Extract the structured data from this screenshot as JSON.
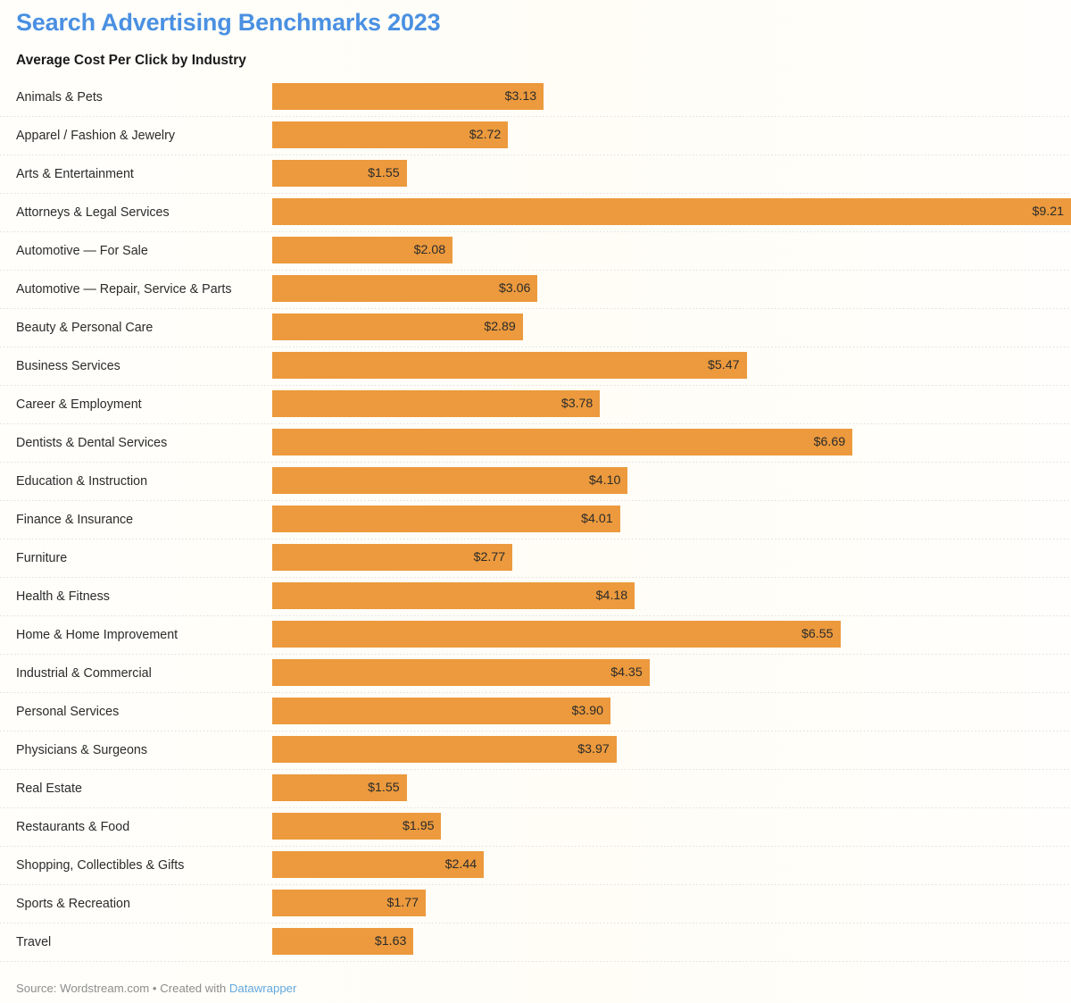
{
  "header": {
    "title": "Search Advertising Benchmarks 2023",
    "subtitle": "Average Cost Per Click by Industry",
    "title_color": "#4a90e2"
  },
  "footer": {
    "source_text": "Source: Wordstream.com • Created with ",
    "link_label": "Datawrapper",
    "link_color": "#62a8dd"
  },
  "style": {
    "bar_color": "#ec9a3d",
    "background": "#fffefb",
    "gridline_color": "#d8d8de",
    "label_color": "#2b2b2b"
  },
  "chart_data": {
    "type": "bar",
    "orientation": "horizontal",
    "title": "Search Advertising Benchmarks 2023",
    "subtitle": "Average Cost Per Click by Industry",
    "xlabel": "",
    "ylabel": "",
    "xlim": [
      0,
      9.21
    ],
    "grid": true,
    "legend": false,
    "value_prefix": "$",
    "value_decimals": 2,
    "source": "Wordstream.com",
    "created_with": "Datawrapper",
    "categories": [
      "Animals & Pets",
      "Apparel / Fashion & Jewelry",
      "Arts & Entertainment",
      "Attorneys & Legal Services",
      "Automotive — For Sale",
      "Automotive — Repair, Service & Parts",
      "Beauty & Personal Care",
      "Business Services",
      "Career & Employment",
      "Dentists & Dental Services",
      "Education & Instruction",
      "Finance & Insurance",
      "Furniture",
      "Health & Fitness",
      "Home & Home Improvement",
      "Industrial & Commercial",
      "Personal Services",
      "Physicians & Surgeons",
      "Real Estate",
      "Restaurants & Food",
      "Shopping, Collectibles & Gifts",
      "Sports & Recreation",
      "Travel"
    ],
    "values": [
      3.13,
      2.72,
      1.55,
      9.21,
      2.08,
      3.06,
      2.89,
      5.47,
      3.78,
      6.69,
      4.1,
      4.01,
      2.77,
      4.18,
      6.55,
      4.35,
      3.9,
      3.97,
      1.55,
      1.95,
      2.44,
      1.77,
      1.63
    ],
    "value_labels": [
      "$3.13",
      "$2.72",
      "$1.55",
      "$9.21",
      "$2.08",
      "$3.06",
      "$2.89",
      "$5.47",
      "$3.78",
      "$6.69",
      "$4.10",
      "$4.01",
      "$2.77",
      "$4.18",
      "$6.55",
      "$4.35",
      "$3.90",
      "$3.97",
      "$1.55",
      "$1.95",
      "$2.44",
      "$1.77",
      "$1.63"
    ]
  }
}
